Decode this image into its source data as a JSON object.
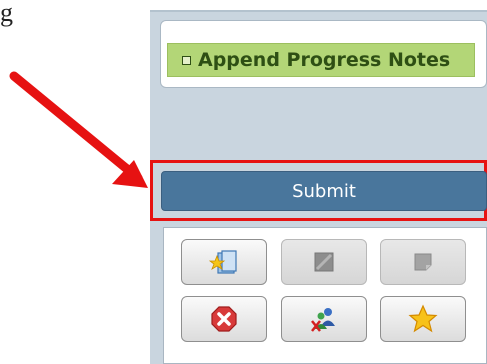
{
  "fragment_text": "g",
  "append_item": {
    "label": "Append Progress Notes"
  },
  "submit": {
    "label": "Submit"
  },
  "toolbar": {
    "buttons": [
      {
        "icon": "folder-star-icon",
        "enabled": true
      },
      {
        "icon": "edit-square-icon",
        "enabled": false
      },
      {
        "icon": "note-icon",
        "enabled": false
      },
      {
        "icon": "cancel-icon",
        "enabled": true
      },
      {
        "icon": "users-remove-icon",
        "enabled": true
      },
      {
        "icon": "star-icon",
        "enabled": true
      }
    ]
  },
  "colors": {
    "highlight": "#e61212",
    "submit_bg": "#49769c",
    "append_bg": "#b3d677",
    "panel_bg": "#c9d5df"
  }
}
